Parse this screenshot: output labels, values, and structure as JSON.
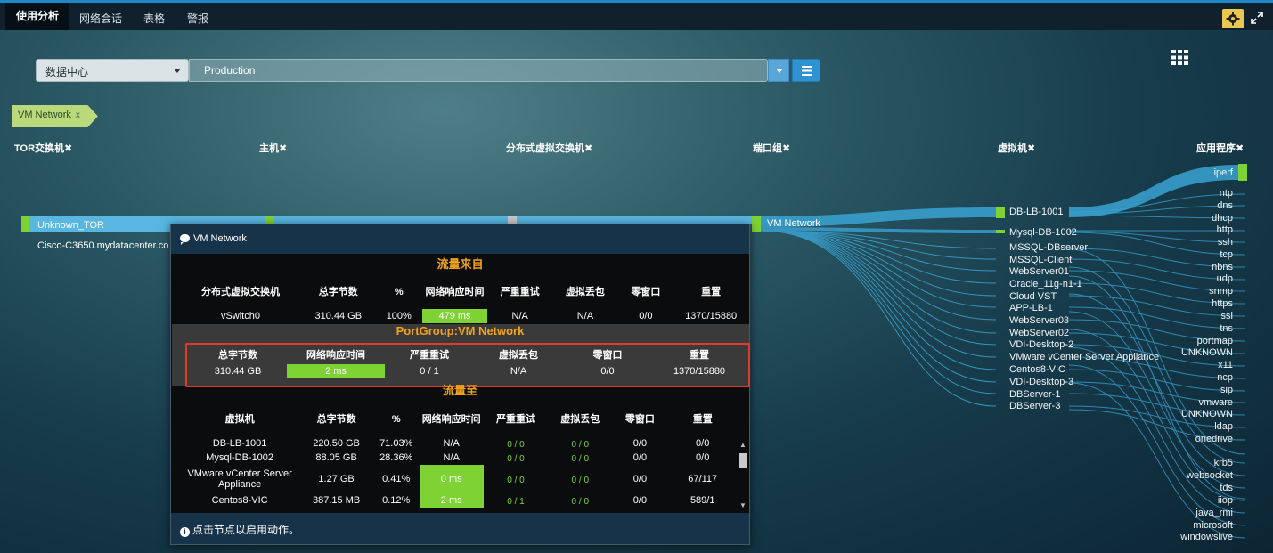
{
  "nav": {
    "tabs": [
      "使用分析",
      "网络会话",
      "表格",
      "警报"
    ]
  },
  "filters": {
    "datacenter_label": "数据中心",
    "production_label": "Production"
  },
  "breadcrumb": {
    "label": "VM Network",
    "close": "x"
  },
  "columns": [
    "TOR交换机✖",
    "主机✖",
    "分布式虚拟交换机✖",
    "端口组✖",
    "虚拟机✖",
    "应用程序✖"
  ],
  "sankey": {
    "tor_nodes": [
      "Unknown_TOR",
      "Cisco-C3650.mydatacenter.co"
    ],
    "portgroup_node": "VM Network",
    "vms": [
      "DB-LB-1001",
      "Mysql-DB-1002",
      "MSSQL-DBserver",
      "MSSQL-Client",
      "WebServer01",
      "Oracle_11g-n1-1",
      "Cloud VST",
      "APP-LB-1",
      "WebServer03",
      "WebServer02",
      "VDI-Desktop-2",
      "VMware vCenter Server Appliance",
      "Centos8-VIC",
      "VDI-Desktop-3",
      "DBServer-1",
      "DBServer-3"
    ],
    "apps": [
      "iperf",
      "ntp",
      "dns",
      "dhcp",
      "http",
      "ssh",
      "tcp",
      "nbns",
      "udp",
      "snmp",
      "https",
      "ssl",
      "tns",
      "portmap",
      "UNKNOWN",
      "x11",
      "ncp",
      "sip",
      "vmware",
      "UNKNOWN",
      "ldap",
      "onedrive",
      "krb5",
      "websocket",
      "tds",
      "iiop",
      "java_rmi",
      "microsoft",
      "windowslive"
    ]
  },
  "popup": {
    "title": "VM Network",
    "from_title": "流量来自",
    "from_headers": [
      "分布式虚拟交换机",
      "总字节数",
      "%",
      "网络响应时间",
      "严重重试",
      "虚拟丢包",
      "零窗口",
      "重置"
    ],
    "from_row": [
      "vSwitch0",
      "310.44 GB",
      "100%",
      "479 ms",
      "N/A",
      "N/A",
      "0/0",
      "1370/15880"
    ],
    "pg_title": "PortGroup:VM Network",
    "pg_headers": [
      "总字节数",
      "网络响应时间",
      "严重重试",
      "虚拟丢包",
      "零窗口",
      "重置"
    ],
    "pg_row": [
      "310.44 GB",
      "2 ms",
      "0 / 1",
      "N/A",
      "0/0",
      "1370/15880"
    ],
    "to_title": "流量至",
    "to_headers": [
      "虚拟机",
      "总字节数",
      "%",
      "网络响应时间",
      "严重重试",
      "虚拟丢包",
      "零窗口",
      "重置"
    ],
    "to_rows": [
      [
        "DB-LB-1001",
        "220.50 GB",
        "71.03%",
        "N/A",
        "0 / 0",
        "0 / 0",
        "0/0",
        "0/0"
      ],
      [
        "Mysql-DB-1002",
        "88.05 GB",
        "28.36%",
        "N/A",
        "0 / 0",
        "0 / 0",
        "0/0",
        "0/0"
      ],
      [
        "VMware vCenter Server Appliance",
        "1.27 GB",
        "0.41%",
        "0 ms",
        "0 / 0",
        "0 / 0",
        "0/0",
        "67/117"
      ],
      [
        "Centos8-VIC",
        "387.15 MB",
        "0.12%",
        "2 ms",
        "0 / 1",
        "0 / 0",
        "0/0",
        "589/1"
      ]
    ],
    "footer": "点击节点以启用动作。"
  },
  "colors": {
    "accent": "#1e88c8",
    "green": "#7fd233",
    "orange": "#f2a31c",
    "flow": "#3ea7d6"
  }
}
